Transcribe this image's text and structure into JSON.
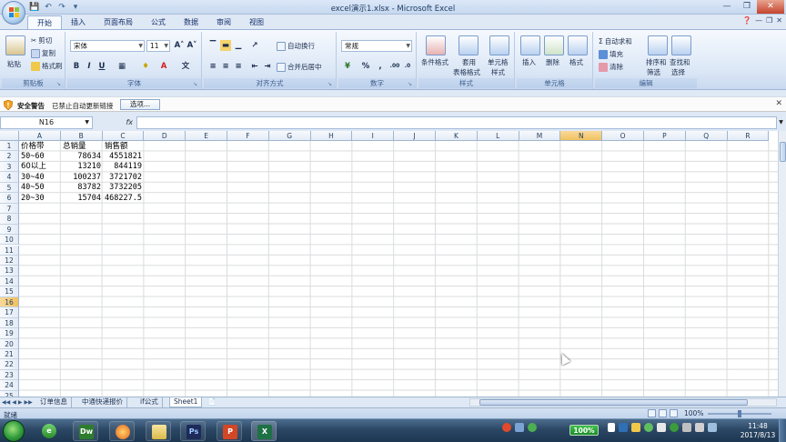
{
  "window": {
    "title": "excel演示1.xlsx - Microsoft Excel"
  },
  "ribbon_tabs": [
    {
      "label": "开始",
      "active": true
    },
    {
      "label": "插入"
    },
    {
      "label": "页面布局"
    },
    {
      "label": "公式"
    },
    {
      "label": "数据"
    },
    {
      "label": "审阅"
    },
    {
      "label": "视图"
    }
  ],
  "ribbon": {
    "clipboard": {
      "paste": "粘贴",
      "cut": "剪切",
      "copy": "复制",
      "format_painter": "格式刷",
      "group": "剪贴板"
    },
    "font": {
      "name": "宋体",
      "size": "11",
      "bold": "B",
      "italic": "I",
      "underline": "U",
      "group": "字体"
    },
    "alignment": {
      "wrap": "自动换行",
      "merge": "合并后居中",
      "group": "对齐方式"
    },
    "number": {
      "format": "常规",
      "percent": "%",
      "comma": ",",
      "group": "数字"
    },
    "styles": {
      "conditional": "条件格式",
      "table_1": "套用",
      "table_2": "表格格式",
      "cell_1": "单元格",
      "cell_2": "样式",
      "group": "样式"
    },
    "cells": {
      "insert": "插入",
      "delete": "删除",
      "format": "格式",
      "group": "单元格"
    },
    "editing": {
      "autosum": "自动求和",
      "fill": "填充",
      "clear": "清除",
      "sort_1": "排序和",
      "sort_2": "筛选",
      "find_1": "查找和",
      "find_2": "选择",
      "group": "编辑"
    }
  },
  "security_bar": {
    "title": "安全警告",
    "message": "已禁止自动更新链接",
    "options_button": "选项..."
  },
  "formula_bar": {
    "name_box": "N16",
    "fx": "fx",
    "value": ""
  },
  "columns": [
    "A",
    "B",
    "C",
    "D",
    "E",
    "F",
    "G",
    "H",
    "I",
    "J",
    "K",
    "L",
    "M",
    "N",
    "O",
    "P",
    "Q",
    "R"
  ],
  "rows": [
    "1",
    "2",
    "3",
    "4",
    "5",
    "6",
    "7",
    "8",
    "9",
    "10",
    "11",
    "12",
    "13",
    "14",
    "15",
    "16",
    "17",
    "18",
    "19",
    "20",
    "21",
    "22",
    "23",
    "24",
    "25"
  ],
  "table": {
    "headers": [
      "价格带",
      "总销量",
      "销售额"
    ],
    "rows": [
      [
        "50~60",
        "78634",
        "4551821"
      ],
      [
        "60以上",
        "13210",
        "844119"
      ],
      [
        "30~40",
        "100237",
        "3721702"
      ],
      [
        "40~50",
        "83782",
        "3732205"
      ],
      [
        "20~30",
        "15704",
        "468227.5"
      ]
    ]
  },
  "sheet_tabs": [
    {
      "label": "订单信息"
    },
    {
      "label": "中通快递报价"
    },
    {
      "label": "if公式"
    },
    {
      "label": "Sheet1",
      "active": true
    }
  ],
  "status_bar": {
    "ready": "就绪",
    "zoom": "100%"
  },
  "taskbar": {
    "battery": "100%",
    "time": "11:48",
    "date": "2017/8/13",
    "apps": [
      "dreamweaver-icon",
      "firefox-icon",
      "explorer-icon",
      "photoshop-icon",
      "powerpoint-icon",
      "excel-icon"
    ]
  },
  "colors": {
    "ribbon_bg": "#dbe7f6",
    "taskbar_bg": "#2b4764",
    "battery_green": "#3fc14b",
    "excel_green": "#1e7145"
  }
}
